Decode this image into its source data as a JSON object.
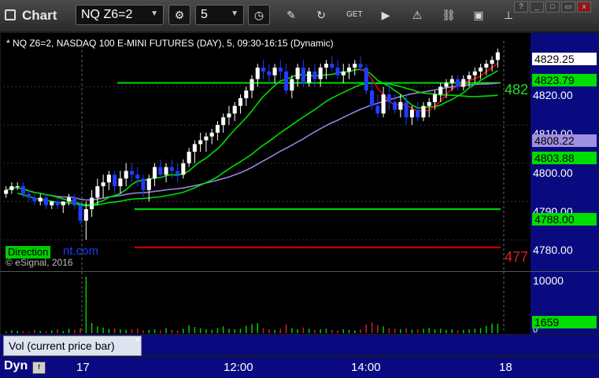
{
  "app": {
    "title": "Chart"
  },
  "toolbar": {
    "symbol": "NQ Z6=2",
    "interval": "5"
  },
  "chart": {
    "description": "* NQ Z6=2, NASDAQ 100 E-MINI FUTURES (DAY), 5, 09:30-16:15 (Dynamic)",
    "copyright": "© eSignal, 2016",
    "watermark_badge": "Direction",
    "watermark_rest": "nt.com",
    "volume_tab": "Vol (current price bar)",
    "volume_close": "×",
    "dyn_label": "Dyn",
    "colors": {
      "up": "#ffffff",
      "down": "#1f3cff",
      "green_line": "#00dd00",
      "red_line": "#dd0000",
      "purple_line": "#9a80e0",
      "scale_bg": "#0a0a80"
    }
  },
  "price_scale": {
    "ticks": [
      "4820.00",
      "4810.00",
      "4800.00",
      "4790.00",
      "4780.00"
    ],
    "labels": [
      {
        "text": "4829.25",
        "bg": "#ffffff"
      },
      {
        "text": "4823.79",
        "bg": "#00dd00"
      },
      {
        "text": "4808.22",
        "bg": "#a090e0"
      },
      {
        "text": "4803.88",
        "bg": "#00dd00"
      },
      {
        "text": "4788.00",
        "bg": "#00dd00"
      }
    ],
    "edge_labels": [
      {
        "text": "482",
        "color": "#22dd22"
      },
      {
        "text": "477",
        "color": "#dd2222"
      }
    ]
  },
  "volume_scale": {
    "ticks": [
      "10000",
      "0"
    ],
    "label": "1659"
  },
  "time_axis": {
    "ticks": [
      "17",
      "12:00",
      "14:00",
      "18"
    ]
  },
  "chart_data": {
    "type": "candlestick",
    "ylim": [
      4772,
      4832
    ],
    "levels": [
      {
        "name": "",
        "value": 4821,
        "color": "#00dd00",
        "from_bar": 20
      },
      {
        "name": "",
        "value": 4788,
        "color": "#00dd00",
        "from_bar": 23
      },
      {
        "name": "",
        "value": 4778,
        "color": "#dd0000",
        "from_bar": 23
      }
    ],
    "candles": [
      [
        4792,
        4794,
        4791,
        4793
      ],
      [
        4793,
        4795,
        4792,
        4794
      ],
      [
        4794,
        4795,
        4793,
        4794
      ],
      [
        4794,
        4795,
        4791,
        4792
      ],
      [
        4792,
        4793,
        4790,
        4791
      ],
      [
        4791,
        4792,
        4789,
        4790
      ],
      [
        4790,
        4792,
        4789,
        4791
      ],
      [
        4791,
        4792,
        4788,
        4789
      ],
      [
        4789,
        4790,
        4788,
        4790
      ],
      [
        4790,
        4791,
        4788,
        4789
      ],
      [
        4789,
        4790,
        4787,
        4790
      ],
      [
        4790,
        4792,
        4789,
        4791
      ],
      [
        4791,
        4792,
        4788,
        4789
      ],
      [
        4789,
        4790,
        4784,
        4785
      ],
      [
        4785,
        4790,
        4780,
        4788
      ],
      [
        4788,
        4793,
        4786,
        4791
      ],
      [
        4791,
        4796,
        4789,
        4794
      ],
      [
        4794,
        4797,
        4791,
        4795
      ],
      [
        4795,
        4798,
        4793,
        4797
      ],
      [
        4797,
        4798,
        4792,
        4794
      ],
      [
        4794,
        4798,
        4792,
        4796
      ],
      [
        4796,
        4800,
        4794,
        4798
      ],
      [
        4798,
        4800,
        4795,
        4797
      ],
      [
        4797,
        4799,
        4794,
        4796
      ],
      [
        4796,
        4797,
        4791,
        4793
      ],
      [
        4793,
        4797,
        4790,
        4796
      ],
      [
        4796,
        4800,
        4794,
        4799
      ],
      [
        4799,
        4801,
        4796,
        4797
      ],
      [
        4797,
        4800,
        4795,
        4799
      ],
      [
        4799,
        4801,
        4796,
        4798
      ],
      [
        4798,
        4800,
        4795,
        4797
      ],
      [
        4797,
        4801,
        4796,
        4800
      ],
      [
        4800,
        4804,
        4799,
        4803
      ],
      [
        4803,
        4806,
        4800,
        4805
      ],
      [
        4805,
        4808,
        4803,
        4806
      ],
      [
        4806,
        4808,
        4803,
        4807
      ],
      [
        4807,
        4809,
        4805,
        4808
      ],
      [
        4808,
        4811,
        4806,
        4810
      ],
      [
        4810,
        4813,
        4808,
        4812
      ],
      [
        4812,
        4815,
        4810,
        4813
      ],
      [
        4813,
        4816,
        4811,
        4815
      ],
      [
        4815,
        4818,
        4813,
        4817
      ],
      [
        4817,
        4820,
        4815,
        4819
      ],
      [
        4819,
        4823,
        4817,
        4822
      ],
      [
        4822,
        4826,
        4820,
        4825
      ],
      [
        4825,
        4827,
        4822,
        4824
      ],
      [
        4824,
        4826,
        4821,
        4823
      ],
      [
        4823,
        4826,
        4821,
        4825
      ],
      [
        4825,
        4827,
        4822,
        4824
      ],
      [
        4824,
        4826,
        4818,
        4819
      ],
      [
        4819,
        4823,
        4817,
        4822
      ],
      [
        4822,
        4826,
        4820,
        4825
      ],
      [
        4825,
        4827,
        4820,
        4821
      ],
      [
        4821,
        4825,
        4820,
        4824
      ],
      [
        4824,
        4826,
        4820,
        4822
      ],
      [
        4822,
        4826,
        4820,
        4825
      ],
      [
        4825,
        4827,
        4822,
        4826
      ],
      [
        4826,
        4828,
        4824,
        4825
      ],
      [
        4825,
        4827,
        4822,
        4823
      ],
      [
        4823,
        4826,
        4821,
        4824
      ],
      [
        4824,
        4826,
        4822,
        4825
      ],
      [
        4825,
        4827,
        4823,
        4826
      ],
      [
        4826,
        4828,
        4824,
        4825
      ],
      [
        4825,
        4826,
        4818,
        4819
      ],
      [
        4819,
        4822,
        4814,
        4815
      ],
      [
        4815,
        4818,
        4812,
        4813
      ],
      [
        4813,
        4820,
        4812,
        4818
      ],
      [
        4818,
        4821,
        4814,
        4816
      ],
      [
        4816,
        4818,
        4813,
        4814
      ],
      [
        4814,
        4818,
        4812,
        4816
      ],
      [
        4816,
        4818,
        4810,
        4812
      ],
      [
        4812,
        4815,
        4810,
        4814
      ],
      [
        4814,
        4816,
        4811,
        4812
      ],
      [
        4812,
        4816,
        4811,
        4815
      ],
      [
        4815,
        4817,
        4812,
        4816
      ],
      [
        4816,
        4819,
        4814,
        4818
      ],
      [
        4818,
        4821,
        4816,
        4820
      ],
      [
        4820,
        4822,
        4817,
        4821
      ],
      [
        4821,
        4823,
        4819,
        4822
      ],
      [
        4822,
        4823,
        4819,
        4820
      ],
      [
        4820,
        4823,
        4819,
        4822
      ],
      [
        4822,
        4824,
        4820,
        4823
      ],
      [
        4823,
        4825,
        4821,
        4824
      ],
      [
        4824,
        4826,
        4822,
        4825
      ],
      [
        4825,
        4827,
        4823,
        4826
      ],
      [
        4826,
        4828,
        4824,
        4827
      ],
      [
        4827,
        4830,
        4825,
        4829
      ]
    ],
    "volume": [
      300,
      500,
      400,
      350,
      250,
      600,
      400,
      300,
      500,
      700,
      400,
      800,
      600,
      900,
      10000,
      1800,
      1200,
      1000,
      800,
      900,
      700,
      600,
      700,
      800,
      500,
      600,
      700,
      500,
      900,
      600,
      500,
      800,
      1400,
      1100,
      900,
      700,
      600,
      900,
      1200,
      800,
      700,
      800,
      1300,
      1600,
      1800,
      900,
      700,
      600,
      800,
      1500,
      900,
      700,
      1000,
      800,
      600,
      700,
      800,
      600,
      500,
      700,
      600,
      500,
      700,
      1500,
      1900,
      1400,
      1200,
      900,
      800,
      700,
      900,
      600,
      700,
      800,
      900,
      700,
      800,
      600,
      700,
      500,
      600,
      700,
      800,
      900,
      1300,
      1700,
      1659
    ]
  }
}
